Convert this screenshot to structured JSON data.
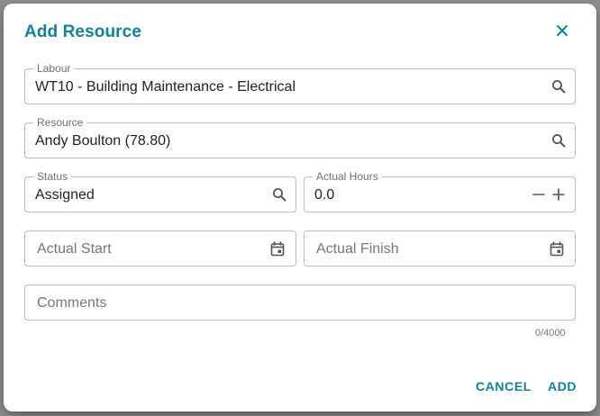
{
  "dialog": {
    "title": "Add Resource",
    "close_icon": "close-icon"
  },
  "fields": {
    "labour": {
      "label": "Labour",
      "value": "WT10 - Building Maintenance - Electrical",
      "icon": "search-icon"
    },
    "resource": {
      "label": "Resource",
      "value": "Andy Boulton (78.80)",
      "icon": "search-icon"
    },
    "status": {
      "label": "Status",
      "value": "Assigned",
      "icon": "search-icon"
    },
    "actual_hours": {
      "label": "Actual Hours",
      "value": "0.0",
      "icons": [
        "minus-icon",
        "plus-icon"
      ]
    },
    "actual_start": {
      "placeholder": "Actual Start",
      "icon": "calendar-icon"
    },
    "actual_finish": {
      "placeholder": "Actual Finish",
      "icon": "calendar-icon"
    },
    "comments": {
      "placeholder": "Comments",
      "counter": "0/4000"
    }
  },
  "actions": {
    "cancel_label": "CANCEL",
    "add_label": "ADD"
  },
  "colors": {
    "accent": "#12838f",
    "border": "#bdbdbd",
    "backdrop": "#8f8f8f"
  }
}
